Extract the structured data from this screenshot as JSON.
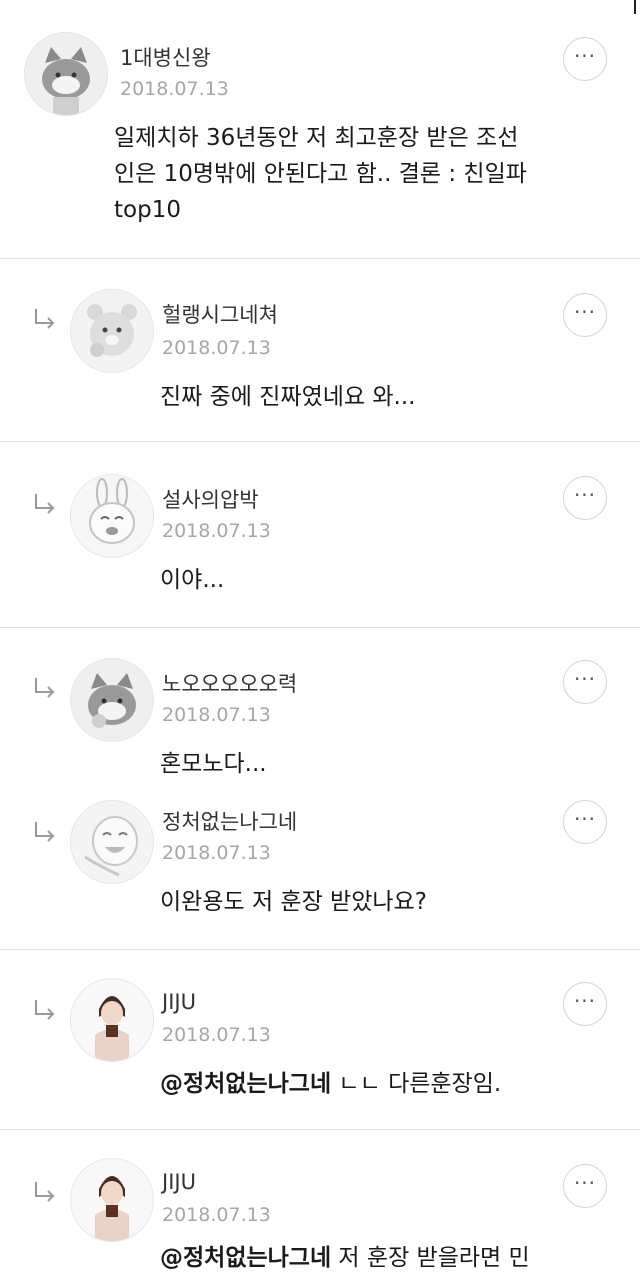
{
  "comments": [
    {
      "name": "1대병신왕",
      "date": "2018.07.13",
      "body": "일제치하 36년동안 저 최고훈장 받은 조선\n인은 10명밖에 안된다고 함.. 결론 : 친일파\ntop10",
      "avatar_icon": "cat-avatar-icon"
    },
    {
      "name": "헐랭시그네쳐",
      "date": "2018.07.13",
      "body": "진짜 중에 진짜였네요 와...",
      "avatar_icon": "bear-avatar-icon"
    },
    {
      "name": "설사의압박",
      "date": "2018.07.13",
      "body": "이야...",
      "avatar_icon": "rabbit-avatar-icon"
    },
    {
      "name": "노오오오오오력",
      "date": "2018.07.13",
      "body": "혼모노다...",
      "avatar_icon": "cat-avatar-icon"
    },
    {
      "name": "정처없는나그네",
      "date": "2018.07.13",
      "body": "이완용도 저 훈장 받았나요?",
      "avatar_icon": "smiley-avatar-icon"
    },
    {
      "name": "JIJU",
      "date": "2018.07.13",
      "mention": "@정처없는나그네",
      "body": " ㄴㄴ 다른훈장임.",
      "avatar_icon": "person-avatar-icon"
    },
    {
      "name": "JIJU",
      "date": "2018.07.13",
      "mention": "@정처없는나그네",
      "body": " 저 훈장 받을라면 민",
      "avatar_icon": "person-avatar-icon"
    }
  ],
  "more_label": "···"
}
